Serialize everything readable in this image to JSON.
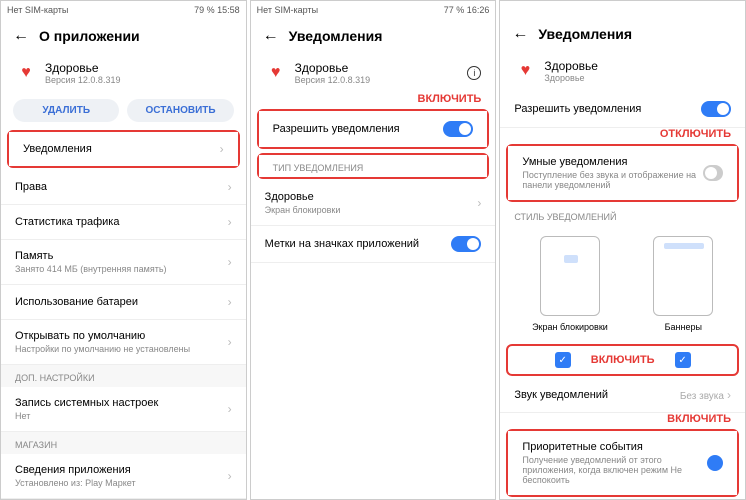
{
  "s1": {
    "status_left": "Нет SIM-карты",
    "status_right": "79 %  15:58",
    "title": "О приложении",
    "app_name": "Здоровье",
    "app_version": "Версия 12.0.8.319",
    "btn_delete": "УДАЛИТЬ",
    "btn_stop": "ОСТАНОВИТЬ",
    "rows": {
      "notifications": "Уведомления",
      "rights": "Права",
      "traffic": "Статистика трафика",
      "memory": "Память",
      "memory_sub": "Занято 414 МБ (внутренняя память)",
      "battery": "Использование батареи",
      "default_open": "Открывать по умолчанию",
      "default_open_sub": "Настройки по умолчанию не установлены",
      "section_extra": "ДОП. НАСТРОЙКИ",
      "sys_settings": "Запись системных настроек",
      "sys_settings_sub": "Нет",
      "section_store": "МАГАЗИН",
      "app_details": "Сведения приложения",
      "app_details_sub": "Установлено из: Play Маркет"
    }
  },
  "s2": {
    "status_left": "Нет SIM-карты",
    "status_right": "77 %  16:26",
    "title": "Уведомления",
    "app_name": "Здоровье",
    "app_version": "Версия 12.0.8.319",
    "annot_enable": "ВКЛЮЧИТЬ",
    "allow": "Разрешить уведомления",
    "section_type": "ТИП УВЕДОМЛЕНИЯ",
    "health": "Здоровье",
    "health_sub": "Экран блокировки",
    "badges": "Метки на значках приложений"
  },
  "s3": {
    "title": "Уведомления",
    "app_name": "Здоровье",
    "app_sub": "Здоровье",
    "allow": "Разрешить уведомления",
    "annot_disable": "ОТКЛЮЧИТЬ",
    "smart": "Умные уведомления",
    "smart_sub": "Поступление без звука и отображение на панели уведомлений",
    "section_style": "СТИЛЬ УВЕДОМЛЕНИЙ",
    "style_lock": "Экран блокировки",
    "style_banner": "Баннеры",
    "annot_enable": "ВКЛЮЧИТЬ",
    "sound": "Звук уведомлений",
    "sound_val": "Без звука",
    "annot_enable2": "ВКЛЮЧИТЬ",
    "priority": "Приоритетные события",
    "priority_sub": "Получение уведомлений от этого приложения, когда включен режим Не беспокоить"
  }
}
